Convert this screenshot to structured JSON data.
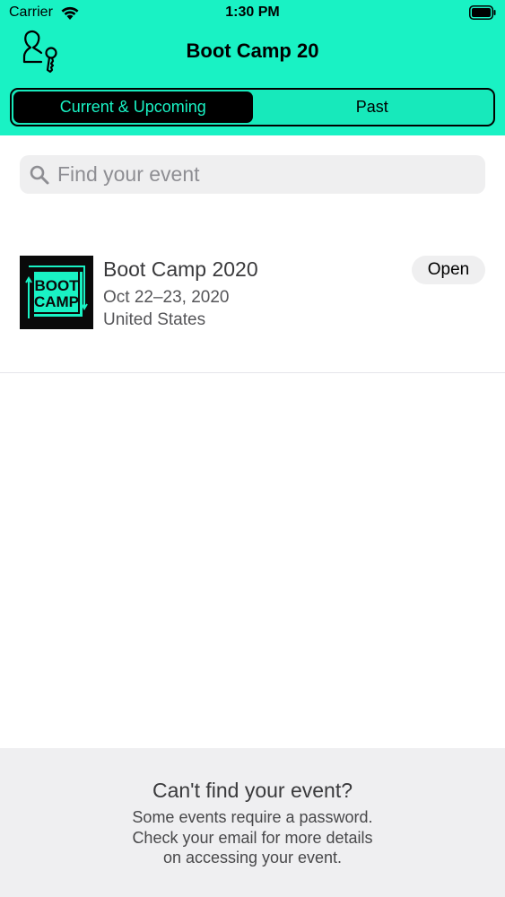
{
  "status_bar": {
    "carrier": "Carrier",
    "time": "1:30 PM"
  },
  "nav": {
    "title": "Boot Camp 20",
    "profile_icon": "user-key-icon"
  },
  "segments": [
    {
      "label": "Current & Upcoming",
      "selected": true
    },
    {
      "label": "Past",
      "selected": false
    }
  ],
  "search": {
    "placeholder": "Find your event",
    "value": ""
  },
  "events": [
    {
      "name": "Boot Camp 2020",
      "dates": "Oct 22–23, 2020",
      "location": "United States",
      "action_label": "Open",
      "logo_text_1": "BOOT",
      "logo_text_2": "CAMP"
    }
  ],
  "footer": {
    "title": "Can't find your event?",
    "line_1": "Some events require a password.",
    "line_2": "Check your email for more details",
    "line_3": "on accessing your event."
  },
  "colors": {
    "accent": "#19f2c4",
    "logo_background": "#0a0a0a"
  }
}
